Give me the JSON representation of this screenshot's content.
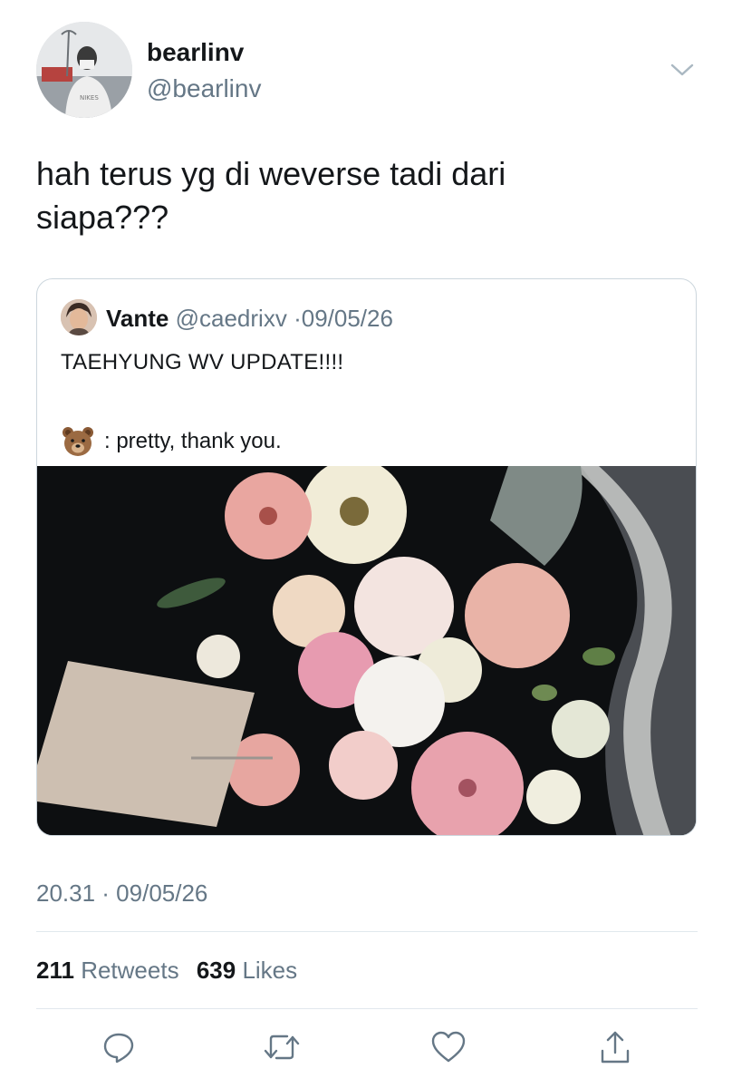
{
  "tweet": {
    "display_name": "bearlinv",
    "handle": "@bearlinv",
    "text_line1": "hah terus yg di weverse tadi dari",
    "text_line2": "siapa???",
    "timestamp": "20.31 · 09/05/26",
    "retweets_count": "211",
    "retweets_label": "Retweets",
    "likes_count": "639",
    "likes_label": "Likes",
    "icons": {
      "menu": "chevron-down-icon",
      "reply": "reply-icon",
      "retweet": "retweet-icon",
      "like": "heart-icon",
      "share": "share-icon"
    }
  },
  "quote": {
    "display_name": "Vante",
    "handle": "@caedrixv",
    "separator": "·",
    "date": "09/05/26",
    "line1": "TAEHYUNG WV UPDATE!!!!",
    "line2_text": ": pretty, thank you.",
    "emoji": "bear-emoji"
  },
  "colors": {
    "text": "#14171a",
    "secondary": "#657786",
    "icon": "#657786",
    "border": "#ccd6dd",
    "divider": "#e1e8ed"
  }
}
